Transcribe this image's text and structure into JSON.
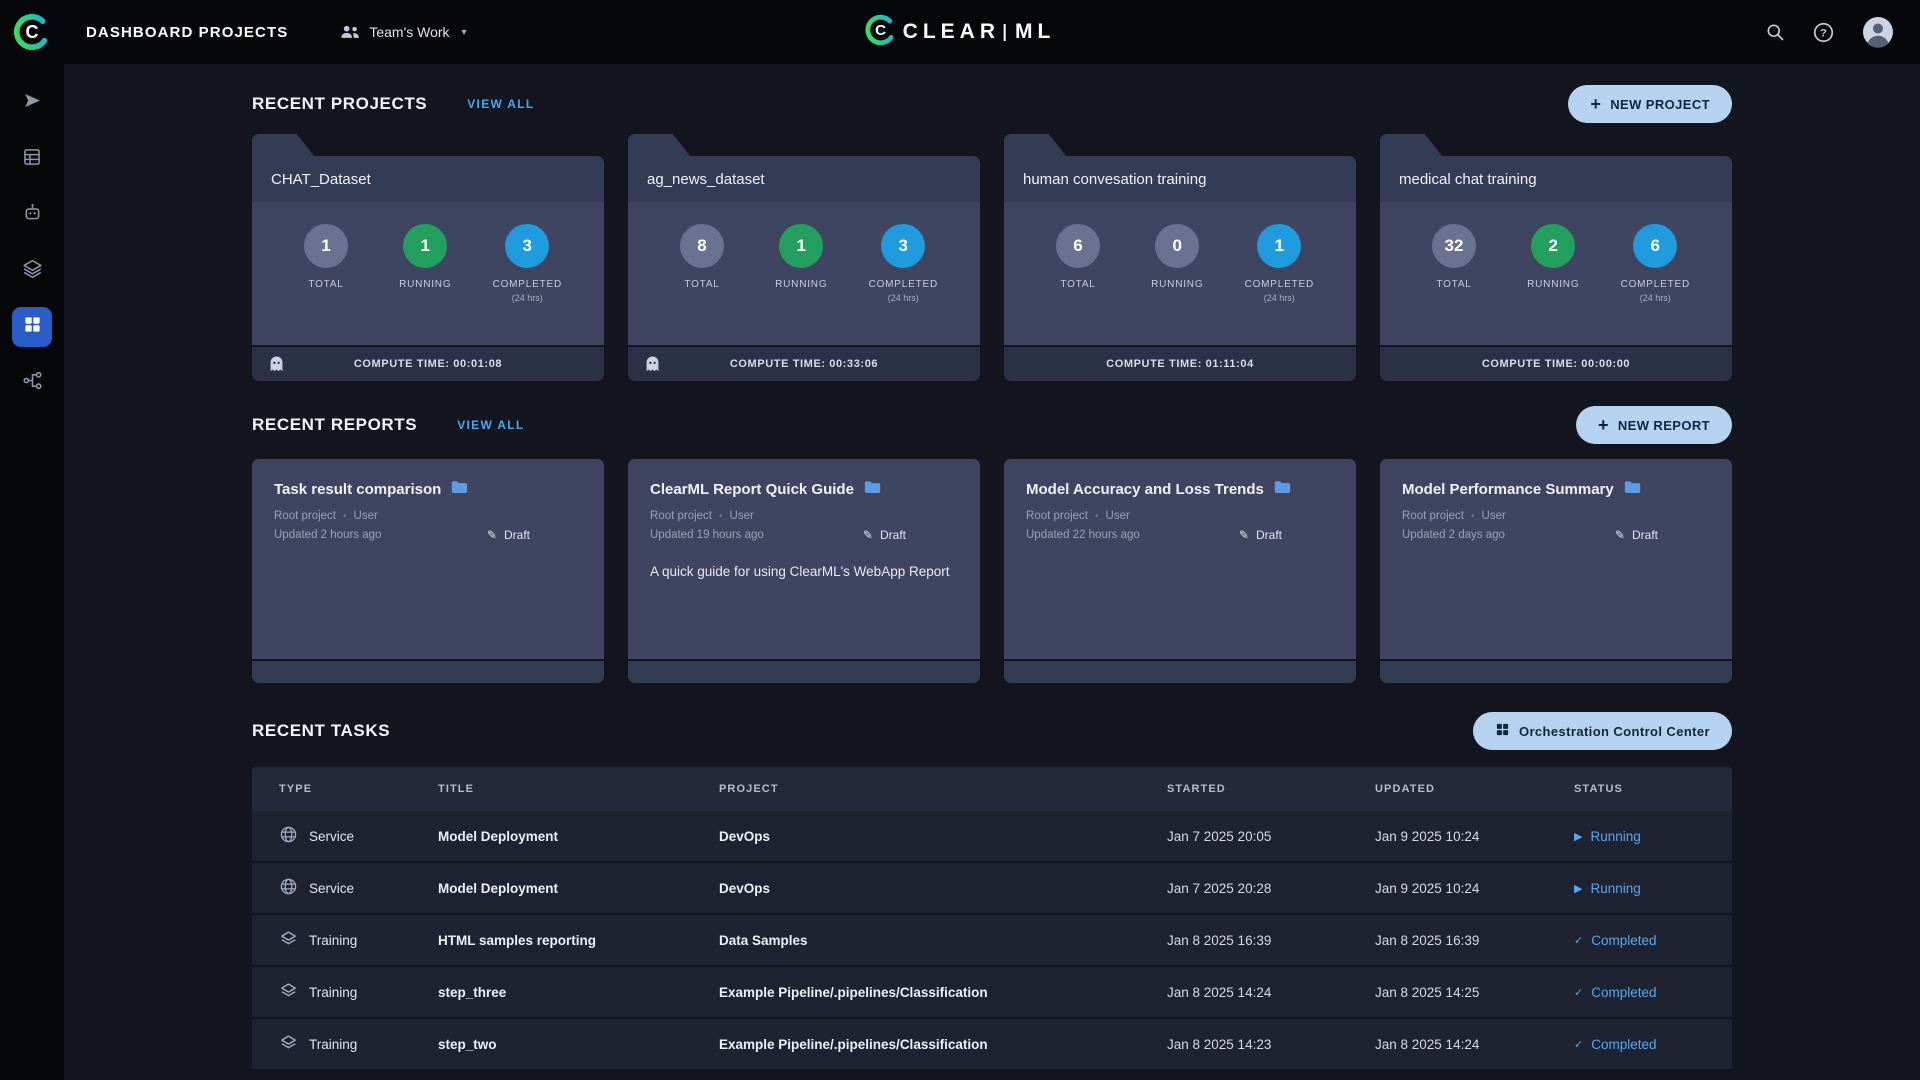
{
  "topbar": {
    "page_title": "DASHBOARD PROJECTS",
    "workspace_label": "Team's Work",
    "logo_clear": "CLEAR",
    "logo_ml": "ML"
  },
  "icons": {
    "plus": "+",
    "caret_down": "▾",
    "draft_pencil": "✎"
  },
  "projects_section": {
    "title": "RECENT PROJECTS",
    "view_all": "VIEW ALL",
    "new_button": "NEW PROJECT",
    "labels": {
      "total": "TOTAL",
      "running": "RUNNING",
      "completed": "COMPLETED",
      "window": "(24 hrs)"
    },
    "cards": [
      {
        "name": "CHAT_Dataset",
        "total": "1",
        "running": "1",
        "completed": "3",
        "compute": "COMPUTE TIME: 00:01:08"
      },
      {
        "name": "ag_news_dataset",
        "total": "8",
        "running": "1",
        "completed": "3",
        "compute": "COMPUTE TIME: 00:33:06"
      },
      {
        "name": "human convesation training",
        "total": "6",
        "running": "0",
        "completed": "1",
        "compute": "COMPUTE TIME: 01:11:04"
      },
      {
        "name": "medical chat training",
        "total": "32",
        "running": "2",
        "completed": "6",
        "compute": "COMPUTE TIME: 00:00:00"
      }
    ]
  },
  "reports_section": {
    "title": "RECENT REPORTS",
    "view_all": "VIEW ALL",
    "new_button": "NEW REPORT",
    "cards": [
      {
        "title": "Task result comparison",
        "project": "Root project",
        "user": "User",
        "updated": "Updated 2 hours ago",
        "badge": "Draft",
        "description": ""
      },
      {
        "title": "ClearML Report Quick Guide",
        "project": "Root project",
        "user": "User",
        "updated": "Updated 19 hours ago",
        "badge": "Draft",
        "description": "A quick guide for using ClearML's WebApp Report"
      },
      {
        "title": "Model Accuracy and Loss Trends",
        "project": "Root project",
        "user": "User",
        "updated": "Updated 22 hours ago",
        "badge": "Draft",
        "description": ""
      },
      {
        "title": "Model Performance Summary",
        "project": "Root project",
        "user": "User",
        "updated": "Updated 2 days ago",
        "badge": "Draft",
        "description": ""
      }
    ]
  },
  "tasks_section": {
    "title": "RECENT TASKS",
    "orchestration_button": "Orchestration Control Center",
    "columns": {
      "type": "TYPE",
      "title": "TITLE",
      "project": "PROJECT",
      "started": "STARTED",
      "updated": "UPDATED",
      "status": "STATUS"
    },
    "rows": [
      {
        "type": "Service",
        "title": "Model Deployment",
        "project": "DevOps",
        "started": "Jan 7 2025 20:05",
        "updated": "Jan 9 2025 10:24",
        "status": "Running",
        "status_icon": "▶"
      },
      {
        "type": "Service",
        "title": "Model Deployment",
        "project": "DevOps",
        "started": "Jan 7 2025 20:28",
        "updated": "Jan 9 2025 10:24",
        "status": "Running",
        "status_icon": "▶"
      },
      {
        "type": "Training",
        "title": "HTML samples reporting",
        "project": "Data Samples",
        "started": "Jan 8 2025 16:39",
        "updated": "Jan 8 2025 16:39",
        "status": "Completed",
        "status_icon": "✓"
      },
      {
        "type": "Training",
        "title": "step_three",
        "project": "Example Pipeline/.pipelines/Classification",
        "started": "Jan 8 2025 14:24",
        "updated": "Jan 8 2025 14:25",
        "status": "Completed",
        "status_icon": "✓"
      },
      {
        "type": "Training",
        "title": "step_two",
        "project": "Example Pipeline/.pipelines/Classification",
        "started": "Jan 8 2025 14:23",
        "updated": "Jan 8 2025 14:24",
        "status": "Completed",
        "status_icon": "✓"
      }
    ]
  },
  "colors": {
    "accent_blue": "#4ba6ee",
    "pill_button_bg": "#b5d2f1",
    "stat_gray": "#6b7290",
    "stat_green": "#23a05f",
    "stat_blue": "#209bdd",
    "status_text": "#59a7f0",
    "active_nav_bg": "#2a5cc8"
  }
}
